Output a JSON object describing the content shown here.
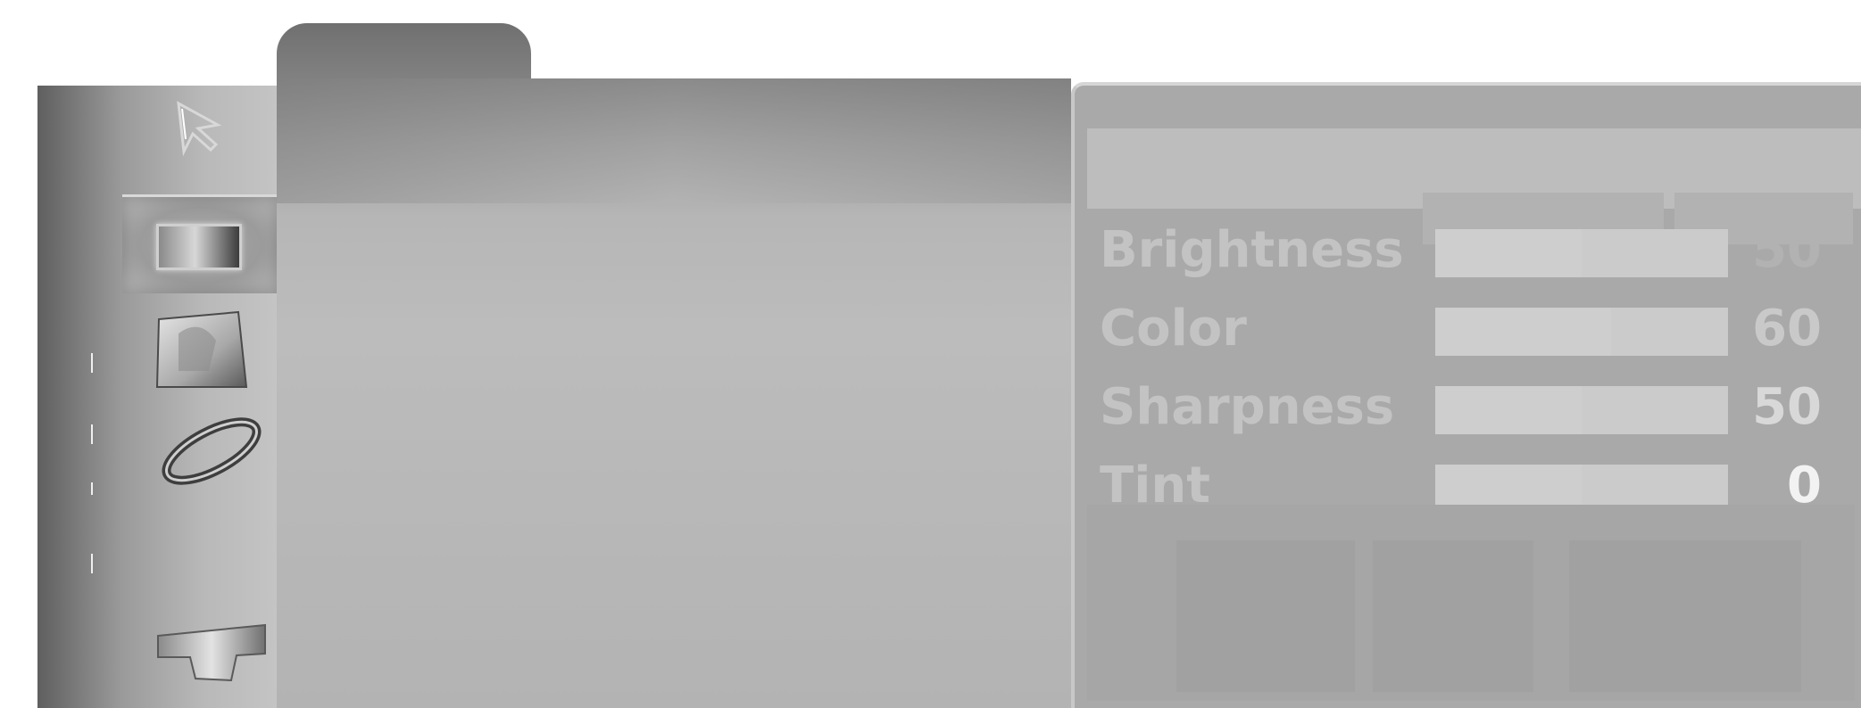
{
  "sidebar": {
    "icons": [
      {
        "name": "cursor-icon"
      },
      {
        "name": "picture-icon",
        "selected": true
      },
      {
        "name": "screen-icon"
      },
      {
        "name": "sound-icon"
      },
      {
        "name": "utility-icon"
      }
    ]
  },
  "settings": {
    "rows": [
      {
        "label": "Brightness",
        "value": "50",
        "level": 0.5
      },
      {
        "label": "Color",
        "value": "60",
        "level": 0.6
      },
      {
        "label": "Sharpness",
        "value": "50",
        "level": 0.5
      },
      {
        "label": "Tint",
        "value": "0",
        "level": 0.5
      }
    ]
  },
  "colors": {
    "panel_gray": "#a9a9a9",
    "sidebar_dark": "#5f5f5f",
    "tab_gray": "#7a7a7a"
  }
}
